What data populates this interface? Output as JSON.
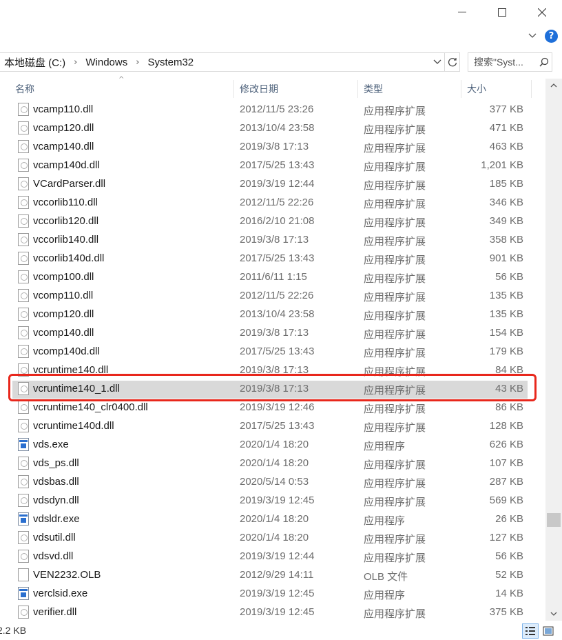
{
  "window": {
    "minimize_glyph": "—",
    "maximize_glyph": "☐",
    "close_glyph": "✕",
    "help_glyph": "?"
  },
  "address": {
    "crumbs": [
      "本地磁盘 (C:)",
      "Windows",
      "System32"
    ],
    "separator": "›"
  },
  "search": {
    "placeholder": "搜索\"Syst..."
  },
  "columns": {
    "name": "名称",
    "date": "修改日期",
    "type": "类型",
    "size": "大小",
    "sort_indicator": "^"
  },
  "files": [
    {
      "name": "vcamp110.dll",
      "date": "2012/11/5 23:26",
      "type": "应用程序扩展",
      "size": "377 KB",
      "icon": "dll-icon"
    },
    {
      "name": "vcamp120.dll",
      "date": "2013/10/4 23:58",
      "type": "应用程序扩展",
      "size": "471 KB",
      "icon": "dll-icon"
    },
    {
      "name": "vcamp140.dll",
      "date": "2019/3/8 17:13",
      "type": "应用程序扩展",
      "size": "463 KB",
      "icon": "dll-icon"
    },
    {
      "name": "vcamp140d.dll",
      "date": "2017/5/25 13:43",
      "type": "应用程序扩展",
      "size": "1,201 KB",
      "icon": "dll-icon"
    },
    {
      "name": "VCardParser.dll",
      "date": "2019/3/19 12:44",
      "type": "应用程序扩展",
      "size": "185 KB",
      "icon": "dll-icon"
    },
    {
      "name": "vccorlib110.dll",
      "date": "2012/11/5 22:26",
      "type": "应用程序扩展",
      "size": "346 KB",
      "icon": "dll-icon"
    },
    {
      "name": "vccorlib120.dll",
      "date": "2016/2/10 21:08",
      "type": "应用程序扩展",
      "size": "349 KB",
      "icon": "dll-icon"
    },
    {
      "name": "vccorlib140.dll",
      "date": "2019/3/8 17:13",
      "type": "应用程序扩展",
      "size": "358 KB",
      "icon": "dll-icon"
    },
    {
      "name": "vccorlib140d.dll",
      "date": "2017/5/25 13:43",
      "type": "应用程序扩展",
      "size": "901 KB",
      "icon": "dll-icon"
    },
    {
      "name": "vcomp100.dll",
      "date": "2011/6/11 1:15",
      "type": "应用程序扩展",
      "size": "56 KB",
      "icon": "dll-icon"
    },
    {
      "name": "vcomp110.dll",
      "date": "2012/11/5 22:26",
      "type": "应用程序扩展",
      "size": "135 KB",
      "icon": "dll-icon"
    },
    {
      "name": "vcomp120.dll",
      "date": "2013/10/4 23:58",
      "type": "应用程序扩展",
      "size": "135 KB",
      "icon": "dll-icon"
    },
    {
      "name": "vcomp140.dll",
      "date": "2019/3/8 17:13",
      "type": "应用程序扩展",
      "size": "154 KB",
      "icon": "dll-icon"
    },
    {
      "name": "vcomp140d.dll",
      "date": "2017/5/25 13:43",
      "type": "应用程序扩展",
      "size": "179 KB",
      "icon": "dll-icon"
    },
    {
      "name": "vcruntime140.dll",
      "date": "2019/3/8 17:13",
      "type": "应用程序扩展",
      "size": "84 KB",
      "icon": "dll-icon"
    },
    {
      "name": "vcruntime140_1.dll",
      "date": "2019/3/8 17:13",
      "type": "应用程序扩展",
      "size": "43 KB",
      "icon": "dll-icon",
      "selected": true
    },
    {
      "name": "vcruntime140_clr0400.dll",
      "date": "2019/3/19 12:46",
      "type": "应用程序扩展",
      "size": "86 KB",
      "icon": "dll-icon"
    },
    {
      "name": "vcruntime140d.dll",
      "date": "2017/5/25 13:43",
      "type": "应用程序扩展",
      "size": "128 KB",
      "icon": "dll-icon"
    },
    {
      "name": "vds.exe",
      "date": "2020/1/4 18:20",
      "type": "应用程序",
      "size": "626 KB",
      "icon": "exe-icon"
    },
    {
      "name": "vds_ps.dll",
      "date": "2020/1/4 18:20",
      "type": "应用程序扩展",
      "size": "107 KB",
      "icon": "dll-icon"
    },
    {
      "name": "vdsbas.dll",
      "date": "2020/5/14 0:53",
      "type": "应用程序扩展",
      "size": "287 KB",
      "icon": "dll-icon"
    },
    {
      "name": "vdsdyn.dll",
      "date": "2019/3/19 12:45",
      "type": "应用程序扩展",
      "size": "569 KB",
      "icon": "dll-icon"
    },
    {
      "name": "vdsldr.exe",
      "date": "2020/1/4 18:20",
      "type": "应用程序",
      "size": "26 KB",
      "icon": "exe-icon"
    },
    {
      "name": "vdsutil.dll",
      "date": "2020/1/4 18:20",
      "type": "应用程序扩展",
      "size": "127 KB",
      "icon": "dll-icon"
    },
    {
      "name": "vdsvd.dll",
      "date": "2019/3/19 12:44",
      "type": "应用程序扩展",
      "size": "56 KB",
      "icon": "dll-icon"
    },
    {
      "name": "VEN2232.OLB",
      "date": "2012/9/29 14:11",
      "type": "OLB 文件",
      "size": "52 KB",
      "icon": "file-icon"
    },
    {
      "name": "verclsid.exe",
      "date": "2019/3/19 12:45",
      "type": "应用程序",
      "size": "14 KB",
      "icon": "exe-icon"
    },
    {
      "name": "verifier.dll",
      "date": "2019/3/19 12:45",
      "type": "应用程序扩展",
      "size": "375 KB",
      "icon": "dll-icon"
    }
  ],
  "status": {
    "text": "2.2 KB"
  },
  "colors": {
    "highlight": "#e8271c",
    "selection": "#d9d9d9",
    "header_text": "#4c607a"
  }
}
